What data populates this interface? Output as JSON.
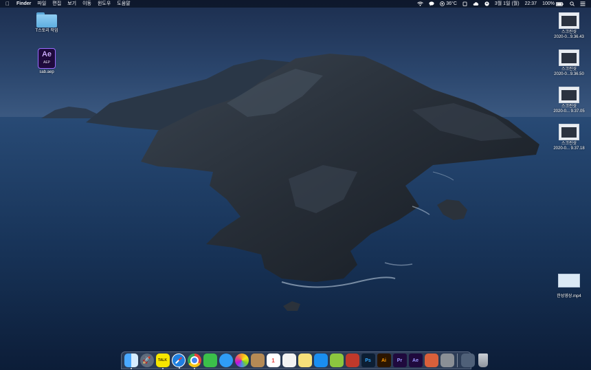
{
  "menubar": {
    "apple_icon": "apple-icon",
    "app_name": "Finder",
    "menus": [
      "파일",
      "편집",
      "보기",
      "이동",
      "윈도우",
      "도움말"
    ],
    "status": {
      "temperature": "36°C",
      "date": "3월 1일 (월)",
      "time": "22:37",
      "battery": "100%"
    }
  },
  "desktop": {
    "left_icons": [
      {
        "label": "T스토리 작업",
        "icon": "folder-icon"
      },
      {
        "label": "sab.aep",
        "icon": "after-effects-project-icon",
        "badge": "Ae",
        "ext": "AEP"
      }
    ],
    "right_icons": [
      {
        "title": "스크린샷",
        "name": "2020-0...9.36.43"
      },
      {
        "title": "스크린샷",
        "name": "2020-0...9.36.50"
      },
      {
        "title": "스크린샷",
        "name": "2020-0... 9.37.05"
      },
      {
        "title": "스크린샷",
        "name": "2020-0... 9.37.18"
      }
    ],
    "video_file": {
      "label": "한성영상.mp4"
    }
  },
  "dock": {
    "apps": [
      {
        "name": "finder",
        "color": "#2d8cf0",
        "running": true
      },
      {
        "name": "launchpad",
        "color": "#5f6b7c",
        "running": false
      },
      {
        "name": "kakaotalk",
        "color": "#f7e600",
        "text": "TALK",
        "running": true
      },
      {
        "name": "safari",
        "color": "#1f7fe0",
        "running": true
      },
      {
        "name": "chrome",
        "color": "#e8453c",
        "running": true
      },
      {
        "name": "facetime",
        "color": "#3bbf4a",
        "running": false
      },
      {
        "name": "messages",
        "color": "#2f9cf5",
        "running": false
      },
      {
        "name": "photos",
        "color": "#f0a030",
        "running": false
      },
      {
        "name": "contacts",
        "color": "#b58a55",
        "running": false
      },
      {
        "name": "calendar",
        "color": "#ffffff",
        "text": "1",
        "running": false
      },
      {
        "name": "reminders",
        "color": "#f3f3f3",
        "running": false
      },
      {
        "name": "notes",
        "color": "#f6e07a",
        "running": false
      },
      {
        "name": "app-store",
        "color": "#1a8ef0",
        "running": false
      },
      {
        "name": "download-app",
        "color": "#8cc63f",
        "running": false
      },
      {
        "name": "recorder",
        "color": "#c0392b",
        "running": false
      },
      {
        "name": "photoshop",
        "color": "#0c1e33",
        "text": "Ps",
        "textColor": "#31a8ff",
        "running": false
      },
      {
        "name": "illustrator",
        "color": "#2b1500",
        "text": "Ai",
        "textColor": "#ff9a00",
        "running": false
      },
      {
        "name": "premiere",
        "color": "#1f0a3d",
        "text": "Pr",
        "textColor": "#9999ff",
        "running": false
      },
      {
        "name": "after-effects",
        "color": "#1f0a3d",
        "text": "Ae",
        "textColor": "#9999ff",
        "running": false
      },
      {
        "name": "fruit-app",
        "color": "#d9603b",
        "running": false
      },
      {
        "name": "system-preferences",
        "color": "#8a8f96",
        "running": false
      }
    ],
    "right_items": [
      {
        "name": "downloads-stack",
        "color": "#4f6078"
      },
      {
        "name": "trash",
        "color": "#a4abb4"
      }
    ]
  }
}
